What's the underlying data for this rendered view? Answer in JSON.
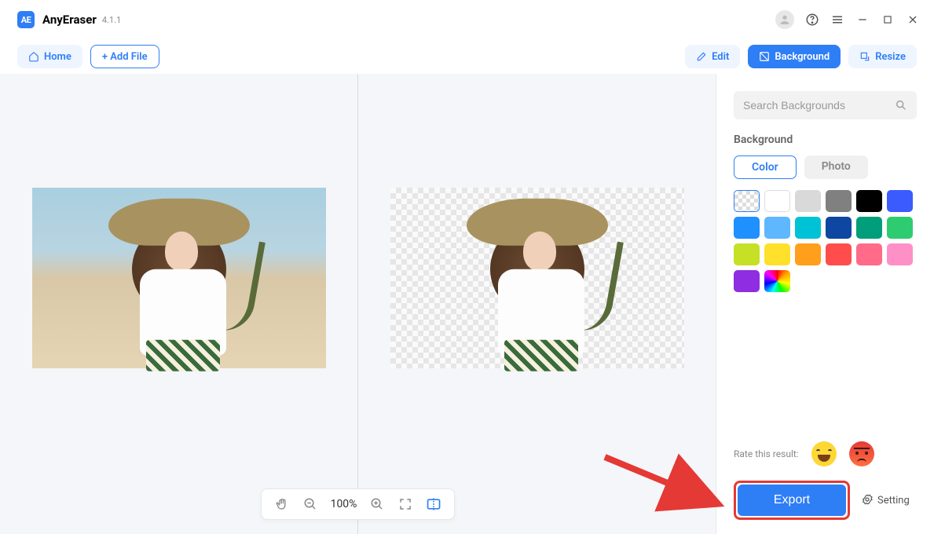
{
  "app": {
    "logo_text": "AE",
    "name": "AnyEraser",
    "version": "4.1.1"
  },
  "toolbar": {
    "home_label": "Home",
    "add_file_label": "+ Add File",
    "edit_label": "Edit",
    "background_label": "Background",
    "resize_label": "Resize"
  },
  "canvas": {
    "zoom_label": "100%"
  },
  "sidebar": {
    "search_placeholder": "Search Backgrounds",
    "section_title": "Background",
    "tabs": {
      "color": "Color",
      "photo": "Photo"
    },
    "swatches": [
      "transparent",
      "#ffffff",
      "#d9d9d9",
      "#808080",
      "#000000",
      "#3b5bff",
      "#1e90ff",
      "#5eb7ff",
      "#00c2d6",
      "#0d47a1",
      "#009e7a",
      "#2ecc71",
      "#c6e026",
      "#ffe02b",
      "#ff9f1c",
      "#ff4d4d",
      "#ff6b88",
      "#ff8fc7",
      "#8e2de2",
      "rainbow"
    ],
    "rate_label": "Rate this result:"
  },
  "actions": {
    "export_label": "Export",
    "setting_label": "Setting"
  }
}
